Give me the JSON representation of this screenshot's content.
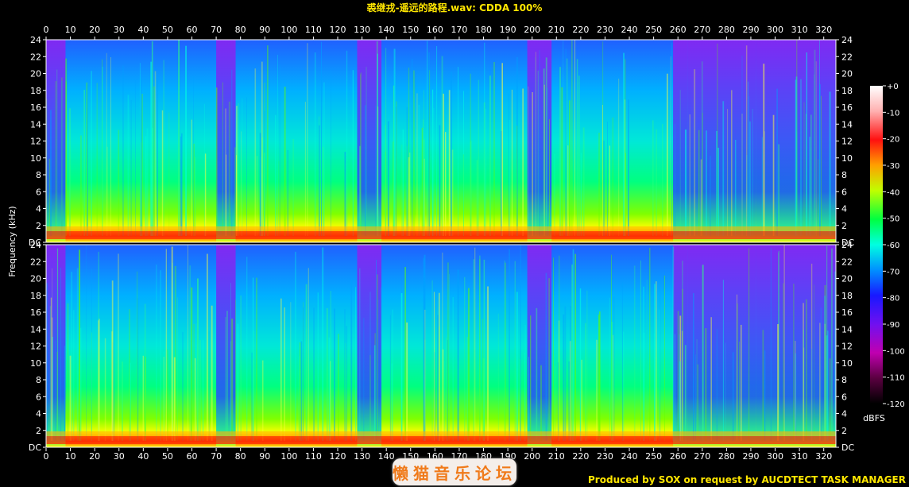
{
  "title": "裘继戎-遥远的路程.wav: CDDA 100%",
  "footer": "Produced by SOX on request by AUCDTECT TASK MANAGER",
  "watermark": "懒猫音乐论坛",
  "colors": {
    "title_text": "#ffe600",
    "axis_frame": "#ffffff",
    "background": "#000000",
    "palette": [
      "#2a0014",
      "#b2009a",
      "#7a10e0",
      "#2020ff",
      "#00c8ff",
      "#00ff90",
      "#50ff00",
      "#ffff00",
      "#ff8c00",
      "#ff1010",
      "#ffc8c8",
      "#ffffff"
    ]
  },
  "chart_data": {
    "type": "heatmap",
    "title": "裘继戎-遥远的路程.wav: CDDA 100%",
    "ylabel": "Frequency (kHz)",
    "xlabel": "",
    "channels": 2,
    "xlim": [
      0,
      325
    ],
    "ylim": [
      0,
      24
    ],
    "x_ticks": [
      0,
      10,
      20,
      30,
      40,
      50,
      60,
      70,
      80,
      90,
      100,
      110,
      120,
      130,
      140,
      150,
      160,
      170,
      180,
      190,
      200,
      210,
      220,
      230,
      240,
      250,
      260,
      270,
      280,
      290,
      300,
      310,
      320
    ],
    "y_ticks": [
      "DC",
      "2",
      "4",
      "6",
      "8",
      "10",
      "12",
      "14",
      "16",
      "18",
      "20",
      "22",
      "24"
    ],
    "colorbar": {
      "label": "dBFS",
      "range": [
        -120,
        0
      ],
      "ticks": [
        "+0",
        "-10",
        "-20",
        "-30",
        "-40",
        "-50",
        "-60",
        "-70",
        "-80",
        "-90",
        "-100",
        "-110",
        "-120"
      ]
    },
    "quiet_segments": [
      {
        "start": 0,
        "end": 8
      },
      {
        "start": 70,
        "end": 78
      },
      {
        "start": 128,
        "end": 138
      },
      {
        "start": 198,
        "end": 208
      },
      {
        "start": 258,
        "end": 264
      },
      {
        "start": 264,
        "end": 292
      },
      {
        "start": 292,
        "end": 325
      }
    ],
    "grid": false
  }
}
